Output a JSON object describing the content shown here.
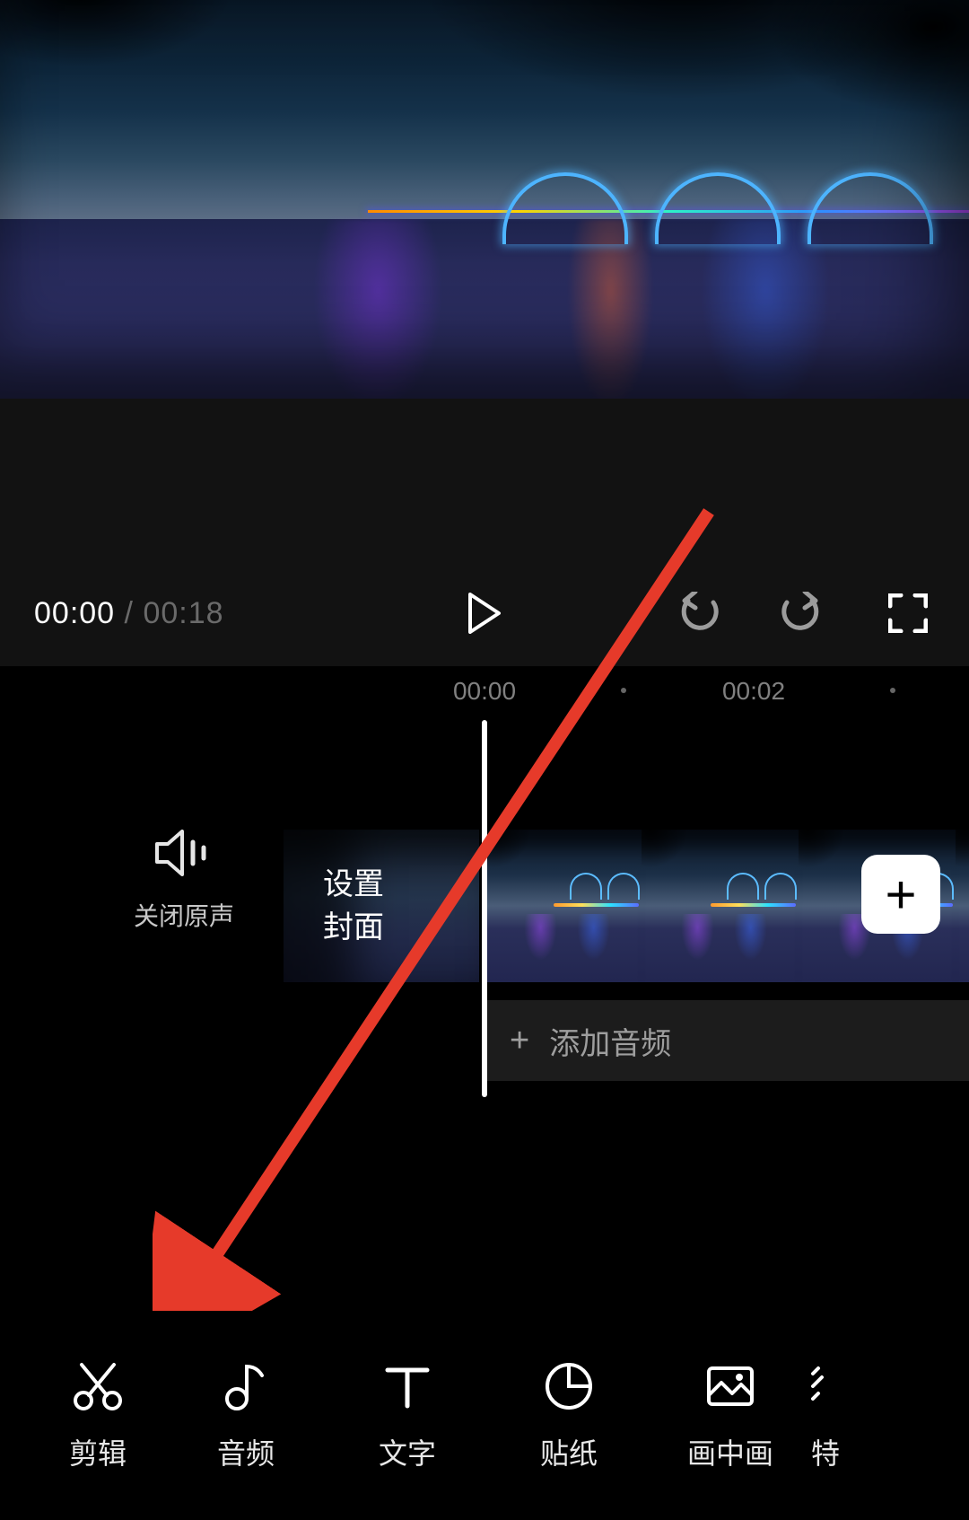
{
  "playbar": {
    "current_time": "00:00",
    "separator": " / ",
    "total_time": "00:18"
  },
  "ruler": {
    "marks": [
      "00:00",
      "00:02"
    ]
  },
  "timeline": {
    "mute_label": "关闭原声",
    "cover_line1": "设置",
    "cover_line2": "封面",
    "add_clip_glyph": "+",
    "audio_plus": "+",
    "add_audio_label": "添加音频"
  },
  "toolbar": {
    "items": [
      {
        "label": "剪辑",
        "icon": "scissors-icon"
      },
      {
        "label": "音频",
        "icon": "music-note-icon"
      },
      {
        "label": "文字",
        "icon": "text-icon"
      },
      {
        "label": "贴纸",
        "icon": "sticker-icon"
      },
      {
        "label": "画中画",
        "icon": "picture-in-picture-icon"
      }
    ],
    "partial_item": {
      "label": "特",
      "icon": "partial-icon"
    }
  }
}
